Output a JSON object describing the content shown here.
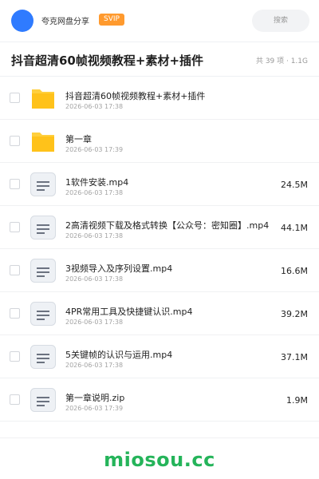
{
  "header": {
    "app_name": "夸克网盘分享",
    "badge": "SVIP",
    "search_placeholder": "搜索"
  },
  "share": {
    "title": "抖音超清60帧视频教程+素材+插件",
    "meta": "共 39 项 · 1.1G"
  },
  "files": [
    {
      "type": "folder",
      "name": "抖音超清60帧视频教程+素材+插件",
      "date": "2026-06-03 17:38",
      "size": ""
    },
    {
      "type": "folder",
      "name": "第一章",
      "date": "2026-06-03 17:39",
      "size": ""
    },
    {
      "type": "file",
      "name": "1软件安装.mp4",
      "date": "2026-06-03 17:38",
      "size": "24.5M"
    },
    {
      "type": "file",
      "name": "2高清视频下载及格式转换【公众号：密知圈】.mp4",
      "date": "2026-06-03 17:38",
      "size": "44.1M"
    },
    {
      "type": "file",
      "name": "3视频导入及序列设置.mp4",
      "date": "2026-06-03 17:38",
      "size": "16.6M"
    },
    {
      "type": "file",
      "name": "4PR常用工具及快捷键认识.mp4",
      "date": "2026-06-03 17:38",
      "size": "39.2M"
    },
    {
      "type": "file",
      "name": "5关键帧的认识与运用.mp4",
      "date": "2026-06-03 17:38",
      "size": "37.1M"
    },
    {
      "type": "file",
      "name": "第一章说明.zip",
      "date": "2026-06-03 17:39",
      "size": "1.9M"
    }
  ],
  "icons": {
    "folder": "folder-icon",
    "file": "document-file-icon"
  },
  "colors": {
    "accent": "#2f7bff",
    "badge": "#ff9a2e",
    "folder": "#ffcf3d",
    "watermark": "#25b45a"
  },
  "watermark": "miosou.cc"
}
